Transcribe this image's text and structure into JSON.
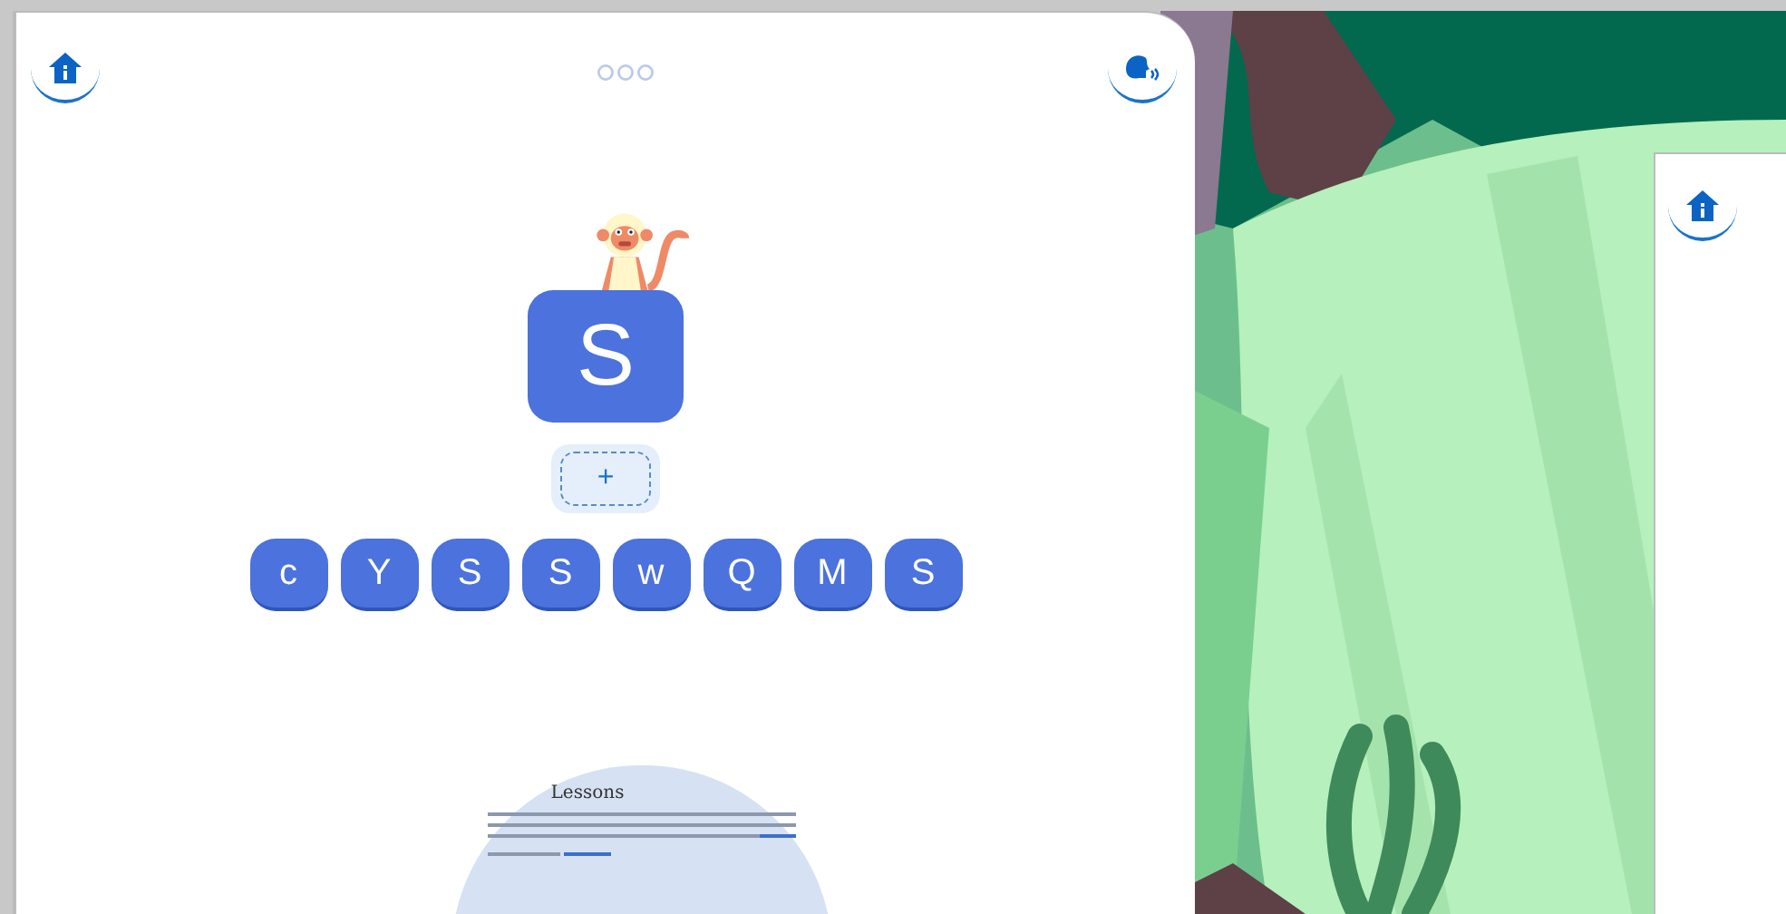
{
  "main_card": {
    "target_letter": "S",
    "answer_slot": {
      "label": "+"
    },
    "letter_tiles": [
      "c",
      "Y",
      "S",
      "S",
      "w",
      "Q",
      "M",
      "S"
    ],
    "preview": {
      "heading": "Lessons"
    }
  }
}
